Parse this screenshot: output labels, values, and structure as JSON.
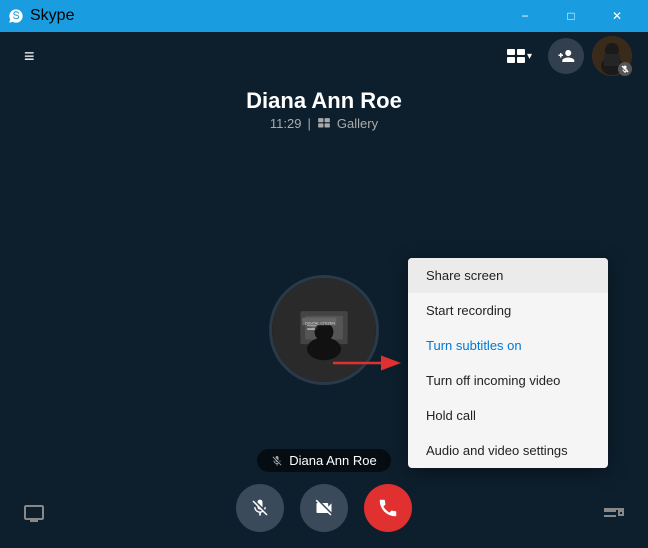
{
  "titleBar": {
    "icon": "skype-icon",
    "title": "Skype",
    "minimizeLabel": "−",
    "maximizeLabel": "□",
    "closeLabel": "✕"
  },
  "topToolbar": {
    "hamburgerIcon": "≡",
    "layoutLabel": "⊞",
    "layoutArrow": "▾",
    "addPeopleIcon": "person-add",
    "avatarBadgeIcon": "mic-off"
  },
  "callInfo": {
    "callerName": "Diana Ann Roe",
    "time": "11:29",
    "separator": "|",
    "galleryIcon": "gallery-icon",
    "galleryLabel": "Gallery"
  },
  "avatar": {
    "alt": "Diana Ann Roe avatar"
  },
  "nameTag": {
    "micIcon": "mic-slash",
    "name": "Diana Ann Roe"
  },
  "controls": {
    "muteLabel": "mute",
    "videoLabel": "video-off",
    "hangupLabel": "hang-up"
  },
  "contextMenu": {
    "items": [
      {
        "id": "share-screen",
        "label": "Share screen",
        "color": "normal"
      },
      {
        "id": "start-recording",
        "label": "Start recording",
        "color": "normal"
      },
      {
        "id": "turn-subtitles-on",
        "label": "Turn subtitles on",
        "color": "blue"
      },
      {
        "id": "turn-off-incoming-video",
        "label": "Turn off incoming video",
        "color": "normal"
      },
      {
        "id": "hold-call",
        "label": "Hold call",
        "color": "normal"
      },
      {
        "id": "audio-video-settings",
        "label": "Audio and video settings",
        "color": "normal"
      }
    ]
  },
  "bottomIcons": {
    "screenShareIcon": "screen-share-icon",
    "moreOptionsIcon": "more-options-icon"
  }
}
